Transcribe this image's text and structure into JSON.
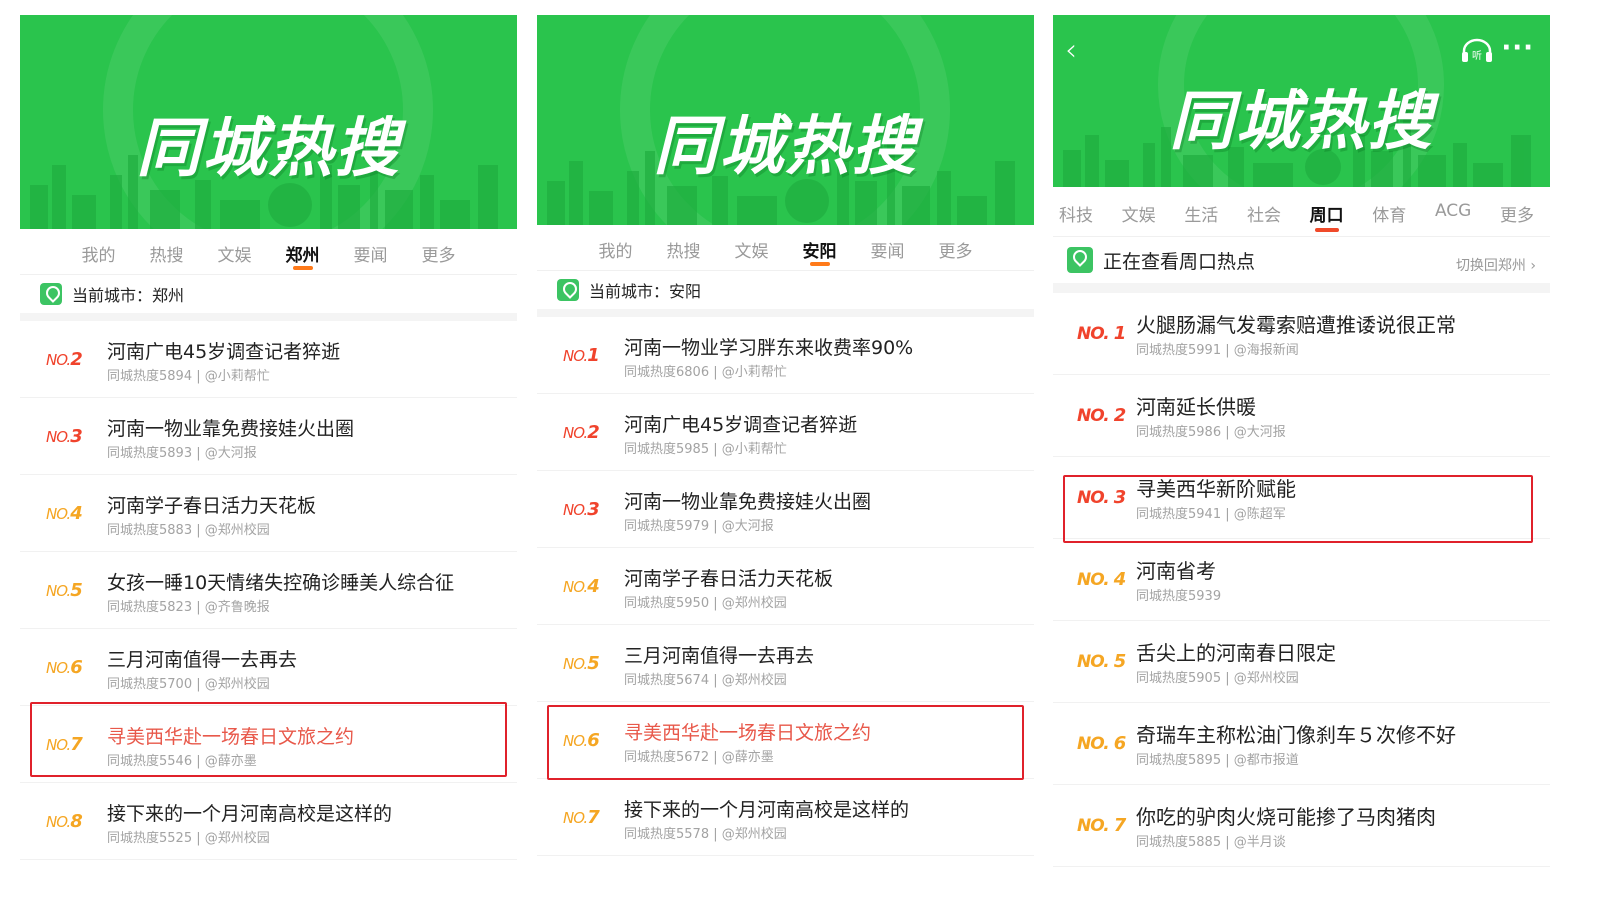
{
  "banner_title": "同城热搜",
  "panels": [
    {
      "tabs": [
        "我的",
        "热搜",
        "文娱",
        "郑州",
        "要闻",
        "更多"
      ],
      "active_tab": "郑州",
      "city_label": "当前城市：郑州",
      "items": [
        {
          "rank_prefix": "NO.",
          "rank": "2",
          "title": "河南广电45岁调查记者猝逝",
          "meta": "同城热度5894 | @小莉帮忙"
        },
        {
          "rank_prefix": "NO.",
          "rank": "3",
          "title": "河南一物业靠免费接娃火出圈",
          "meta": "同城热度5893 | @大河报"
        },
        {
          "rank_prefix": "NO.",
          "rank": "4",
          "title": "河南学子春日活力天花板",
          "meta": "同城热度5883 | @郑州校园"
        },
        {
          "rank_prefix": "NO.",
          "rank": "5",
          "title": "女孩一睡10天情绪失控确诊睡美人综合征",
          "meta": "同城热度5823 | @齐鲁晚报"
        },
        {
          "rank_prefix": "NO.",
          "rank": "6",
          "title": "三月河南值得一去再去",
          "meta": "同城热度5700 | @郑州校园"
        },
        {
          "rank_prefix": "NO.",
          "rank": "7",
          "title": "寻美西华赴一场春日文旅之约",
          "meta": "同城热度5546 | @薛亦墨"
        },
        {
          "rank_prefix": "NO.",
          "rank": "8",
          "title": "接下来的一个月河南高校是这样的",
          "meta": "同城热度5525 | @郑州校园"
        }
      ]
    },
    {
      "tabs": [
        "我的",
        "热搜",
        "文娱",
        "安阳",
        "要闻",
        "更多"
      ],
      "active_tab": "安阳",
      "city_label": "当前城市：安阳",
      "items": [
        {
          "rank_prefix": "NO.",
          "rank": "1",
          "title": "河南一物业学习胖东来收费率90%",
          "meta": "同城热度6806 | @小莉帮忙"
        },
        {
          "rank_prefix": "NO.",
          "rank": "2",
          "title": "河南广电45岁调查记者猝逝",
          "meta": "同城热度5985 | @小莉帮忙"
        },
        {
          "rank_prefix": "NO.",
          "rank": "3",
          "title": "河南一物业靠免费接娃火出圈",
          "meta": "同城热度5979 | @大河报"
        },
        {
          "rank_prefix": "NO.",
          "rank": "4",
          "title": "河南学子春日活力天花板",
          "meta": "同城热度5950 | @郑州校园"
        },
        {
          "rank_prefix": "NO.",
          "rank": "5",
          "title": "三月河南值得一去再去",
          "meta": "同城热度5674 | @郑州校园"
        },
        {
          "rank_prefix": "NO.",
          "rank": "6",
          "title": "寻美西华赴一场春日文旅之约",
          "meta": "同城热度5672 | @薛亦墨"
        },
        {
          "rank_prefix": "NO.",
          "rank": "7",
          "title": "接下来的一个月河南高校是这样的",
          "meta": "同城热度5578 | @郑州校园"
        }
      ]
    },
    {
      "tabs": [
        "科技",
        "文娱",
        "生活",
        "社会",
        "周口",
        "体育",
        "ACG",
        "更多"
      ],
      "active_tab": "周口",
      "city_label": "正在查看周口热点",
      "switch_label": "切换回郑州 ›",
      "listen_label": "听",
      "items": [
        {
          "rank_prefix": "NO. ",
          "rank": "1",
          "title": "火腿肠漏气发霉索赔遭推诿说很正常",
          "meta": "同城热度5991 | @海报新闻"
        },
        {
          "rank_prefix": "NO. ",
          "rank": "2",
          "title": "河南延长供暖",
          "meta": "同城热度5986 | @大河报"
        },
        {
          "rank_prefix": "NO. ",
          "rank": "3",
          "title": "寻美西华新阶赋能",
          "meta": "同城热度5941 | @陈超军"
        },
        {
          "rank_prefix": "NO. ",
          "rank": "4",
          "title": "河南省考",
          "meta": "同城热度5939"
        },
        {
          "rank_prefix": "NO. ",
          "rank": "5",
          "title": "舌尖上的河南春日限定",
          "meta": "同城热度5905 | @郑州校园"
        },
        {
          "rank_prefix": "NO. ",
          "rank": "6",
          "title": "奇瑞车主称松油门像刹车５次修不好",
          "meta": "同城热度5895 | @都市报道"
        },
        {
          "rank_prefix": "NO. ",
          "rank": "7",
          "title": "你吃的驴肉火烧可能掺了马肉猪肉",
          "meta": "同城热度5885 | @半月谈"
        }
      ]
    }
  ]
}
